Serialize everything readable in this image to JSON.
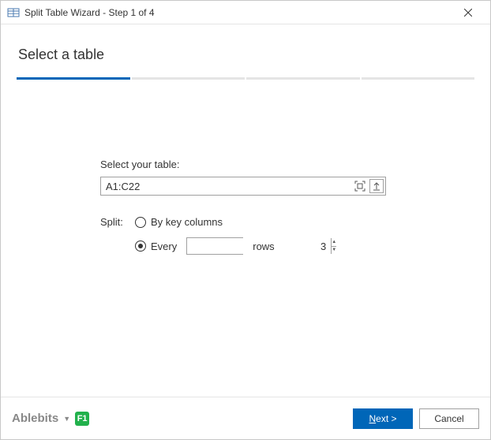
{
  "window": {
    "title": "Split Table Wizard - Step 1 of 4"
  },
  "progress": {
    "total_steps": 4,
    "current_step": 1
  },
  "page": {
    "heading": "Select a table",
    "select_label": "Select your table:",
    "range_value": "A1:C22",
    "split_label": "Split:",
    "radio_key_columns": "By key columns",
    "radio_every": "Every",
    "rows_suffix": "rows",
    "rows_value": "3",
    "selected_mode": "every"
  },
  "footer": {
    "brand": "Ablebits",
    "help_badge": "F1",
    "next_prefix": "N",
    "next_suffix": "ext >",
    "cancel": "Cancel"
  }
}
